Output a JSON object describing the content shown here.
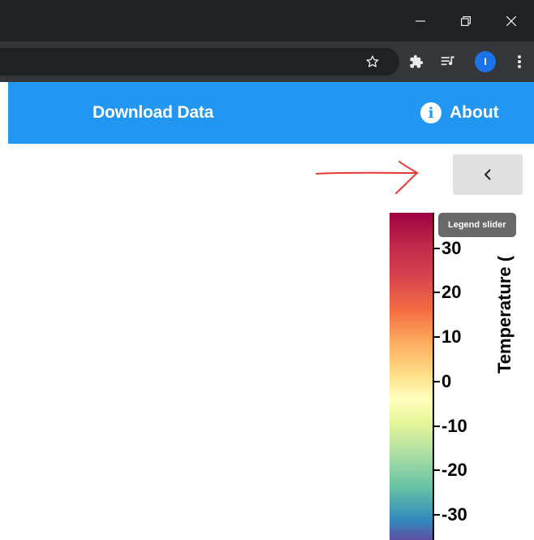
{
  "browser": {
    "window_controls": {
      "minimize": "minimize-icon",
      "restore": "restore-icon",
      "close": "close-icon"
    },
    "toolbar": {
      "profile_initial": "I"
    }
  },
  "navbar": {
    "download_label": "Download Data",
    "about_label": "About",
    "about_icon_glyph": "i",
    "color": "#2196f3"
  },
  "legend": {
    "toggle_glyph": "‹",
    "tooltip": "Legend slider",
    "title": "Temperature (",
    "ticks": [
      "30",
      "20",
      "10",
      "0",
      "-10",
      "-20",
      "-30"
    ]
  },
  "annotation": {
    "arrow_color": "#e53935"
  }
}
